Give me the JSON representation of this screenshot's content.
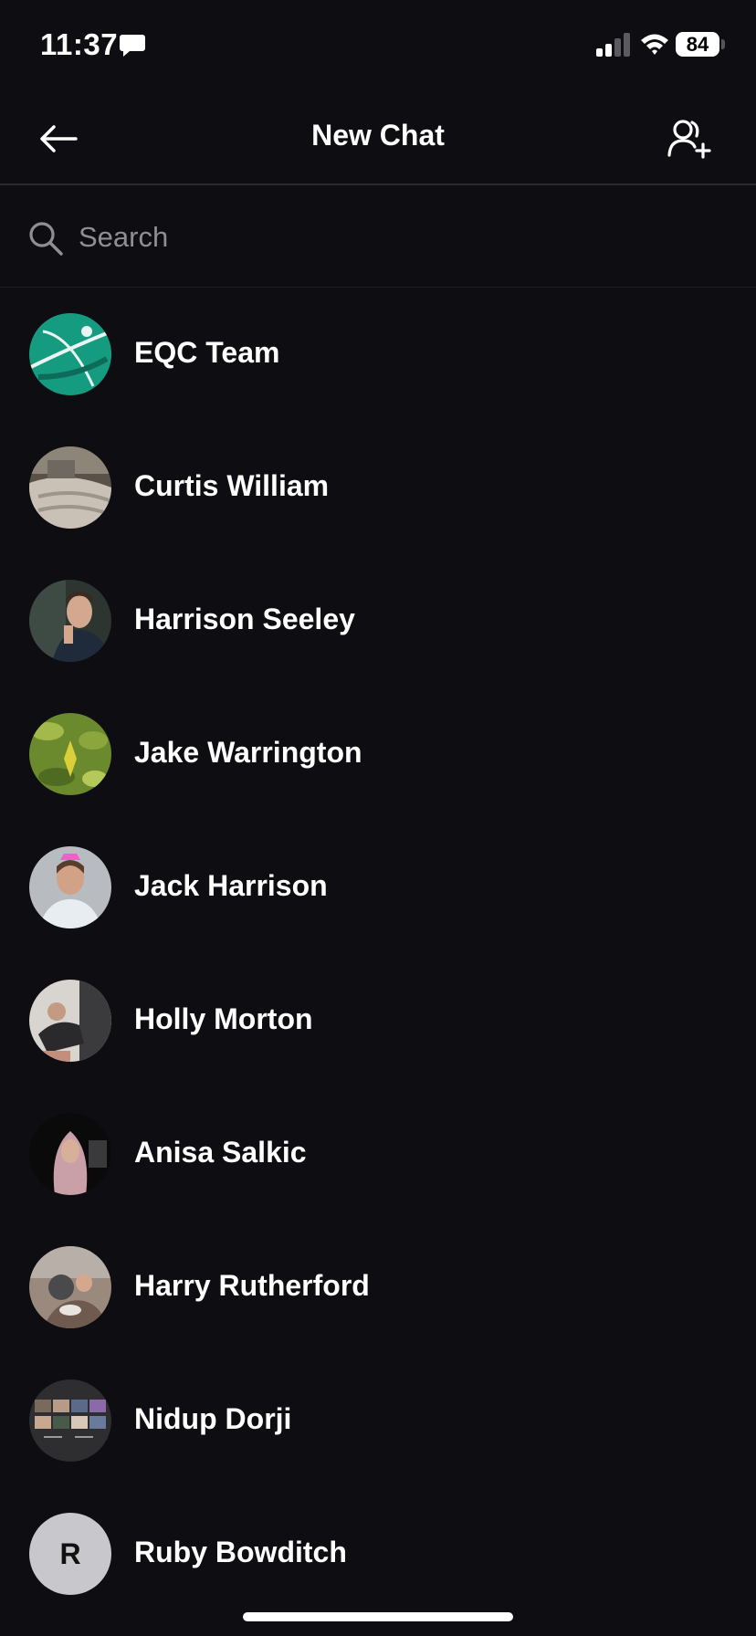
{
  "status_bar": {
    "time": "11:37",
    "battery": "84",
    "icons": [
      "message-bubble-icon",
      "signal-icon",
      "wifi-icon",
      "battery-icon"
    ]
  },
  "header": {
    "title": "New Chat",
    "back_icon": "arrow-left-icon",
    "action_icon": "add-user-icon"
  },
  "search": {
    "placeholder": "Search",
    "value": ""
  },
  "contacts": [
    {
      "name": "EQC Team",
      "avatar": "photo"
    },
    {
      "name": "Curtis William",
      "avatar": "photo"
    },
    {
      "name": "Harrison Seeley",
      "avatar": "photo"
    },
    {
      "name": "Jake Warrington",
      "avatar": "photo"
    },
    {
      "name": "Jack Harrison",
      "avatar": "photo"
    },
    {
      "name": "Holly Morton",
      "avatar": "photo"
    },
    {
      "name": "Anisa Salkic",
      "avatar": "photo"
    },
    {
      "name": "Harry Rutherford",
      "avatar": "photo"
    },
    {
      "name": "Nidup Dorji",
      "avatar": "photo"
    },
    {
      "name": "Ruby Bowditch",
      "avatar": "initial",
      "initial": "R"
    }
  ],
  "colors": {
    "background": "#0e0e12",
    "text": "#ffffff",
    "placeholder": "#8e8e93",
    "divider": "#2a2a30",
    "initial_avatar_bg": "#c7c7cc"
  }
}
